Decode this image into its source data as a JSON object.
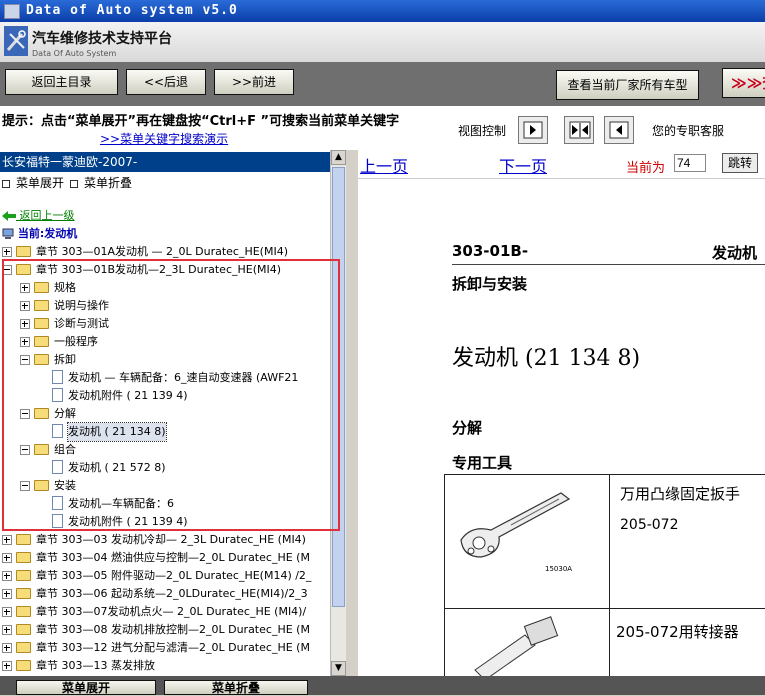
{
  "window": {
    "title": "Data of Auto system v5.0"
  },
  "brand": {
    "title": "汽车维修技术支持平台",
    "subtitle": "Data Of Auto System"
  },
  "nav": {
    "home": "返回主目录",
    "back": "<<后退",
    "forward": ">>前进",
    "all_models": "查看当前厂家所有车型",
    "red_button": "≫≫查"
  },
  "hint": {
    "text": "提示：点击“菜单展开”再在键盘按“Ctrl+F ”可搜索当前菜单关键字",
    "link": ">>菜单关键字搜索演示",
    "view_control": "视图控制",
    "service": "您的专职客服"
  },
  "tree": {
    "header": "长安福特一蒙迪欧-2007-",
    "expand": "菜单展开",
    "collapse": "菜单折叠",
    "back_up": "返回上一级",
    "current": "当前:发动机",
    "rows": [
      {
        "label": "章节  303—01A发动机 — 2_0L Duratec_HE(MI4)"
      },
      {
        "label": "章节  303—01B发动机—2_3L Duratec_HE(MI4)"
      },
      {
        "label": "规格"
      },
      {
        "label": "说明与操作"
      },
      {
        "label": "诊断与测试"
      },
      {
        "label": "一般程序"
      },
      {
        "label": "拆卸"
      },
      {
        "label": "发动机 — 车辆配备：6_速自动变速器 (AWF21"
      },
      {
        "label": "发动机附件 ( 21 139 4)"
      },
      {
        "label": "分解"
      },
      {
        "label": "发动机 ( 21 134 8)"
      },
      {
        "label": "组合"
      },
      {
        "label": "发动机 ( 21 572 8)"
      },
      {
        "label": "安装"
      },
      {
        "label": "发动机—车辆配备：6"
      },
      {
        "label": "发动机附件 ( 21 139 4)"
      },
      {
        "label": "章节  303—03 发动机冷却— 2_3L Duratec_HE (MI4)"
      },
      {
        "label": "章节  303—04 燃油供应与控制—2_0L Duratec_HE (M"
      },
      {
        "label": "章节  303—05 附件驱动—2_0L Duratec_HE(M14) /2_"
      },
      {
        "label": "章节  303—06 起动系统—2_0LDuratec_HE(MI4)/2_3"
      },
      {
        "label": "章节  303—07发动机点火— 2_0L Duratec_HE (MI4)/"
      },
      {
        "label": "章节  303—08 发动机排放控制—2_0L Duratec_HE (M"
      },
      {
        "label": "章节  303—12 进气分配与滤清—2_0L Duratec_HE (M"
      },
      {
        "label": "章节  303—13 蒸发排放"
      }
    ]
  },
  "bottom": {
    "expand": "菜单展开",
    "collapse": "菜单折叠"
  },
  "viewer": {
    "prev": "上一页",
    "next": "下一页",
    "current_label": "当前为",
    "page": "74",
    "jump": "跳转",
    "doc_code": "303-01B-",
    "doc_code_right": "发动机",
    "section": "拆卸与安装",
    "heading": "发动机 (21 134 8)",
    "sub1": "分解",
    "sub2": "专用工具",
    "tool1_name": "万用凸缘固定扳手",
    "tool1_code": "205-072",
    "tool1_caption": "15030A",
    "tool2_name": "205-072用转接器"
  },
  "colors": {
    "tree_header": "#003f8a",
    "highlight_box": "#e0303a",
    "link": "#0000cc"
  }
}
